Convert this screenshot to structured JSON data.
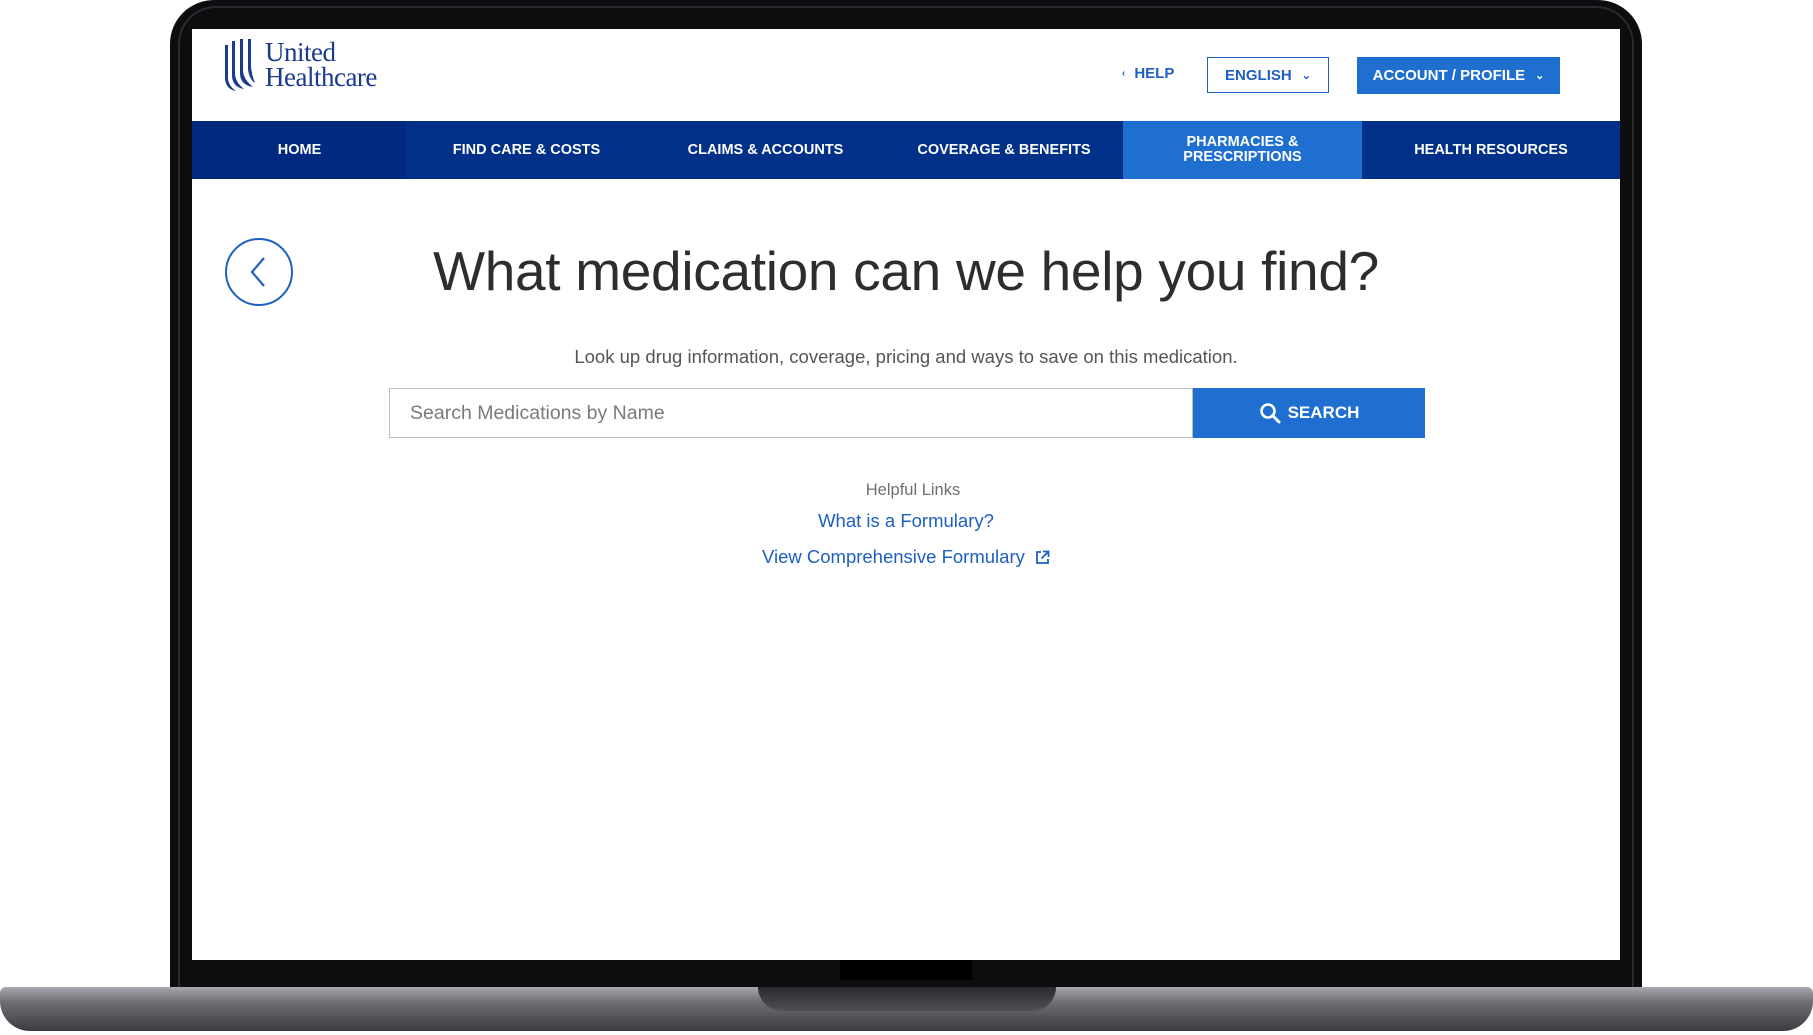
{
  "header": {
    "logo_line1": "United",
    "logo_line2": "Healthcare",
    "help_label": "HELP",
    "language_label": "ENGLISH",
    "account_label": "ACCOUNT / PROFILE"
  },
  "nav": {
    "items": [
      {
        "label": "HOME"
      },
      {
        "label": "FIND CARE & COSTS"
      },
      {
        "label": "CLAIMS & ACCOUNTS"
      },
      {
        "label": "COVERAGE & BENEFITS"
      },
      {
        "label": "PHARMACIES & PRESCRIPTIONS",
        "active": true
      },
      {
        "label": "HEALTH RESOURCES"
      }
    ]
  },
  "main": {
    "title": "What medication can we help you find?",
    "subtitle": "Look up drug information, coverage, pricing and ways to save on this medication.",
    "search_placeholder": "Search Medications by Name",
    "search_button": "SEARCH",
    "helpful_links_title": "Helpful Links",
    "link_formulary": "What is a Formulary?",
    "link_comprehensive": "View Comprehensive Formulary"
  },
  "icons": {
    "back": "chevron-left-icon",
    "search": "search-icon",
    "external": "external-link-icon"
  },
  "colors": {
    "brand_navy": "#003087",
    "accent_blue": "#1e6fd0",
    "link_blue": "#1d5fc2"
  }
}
